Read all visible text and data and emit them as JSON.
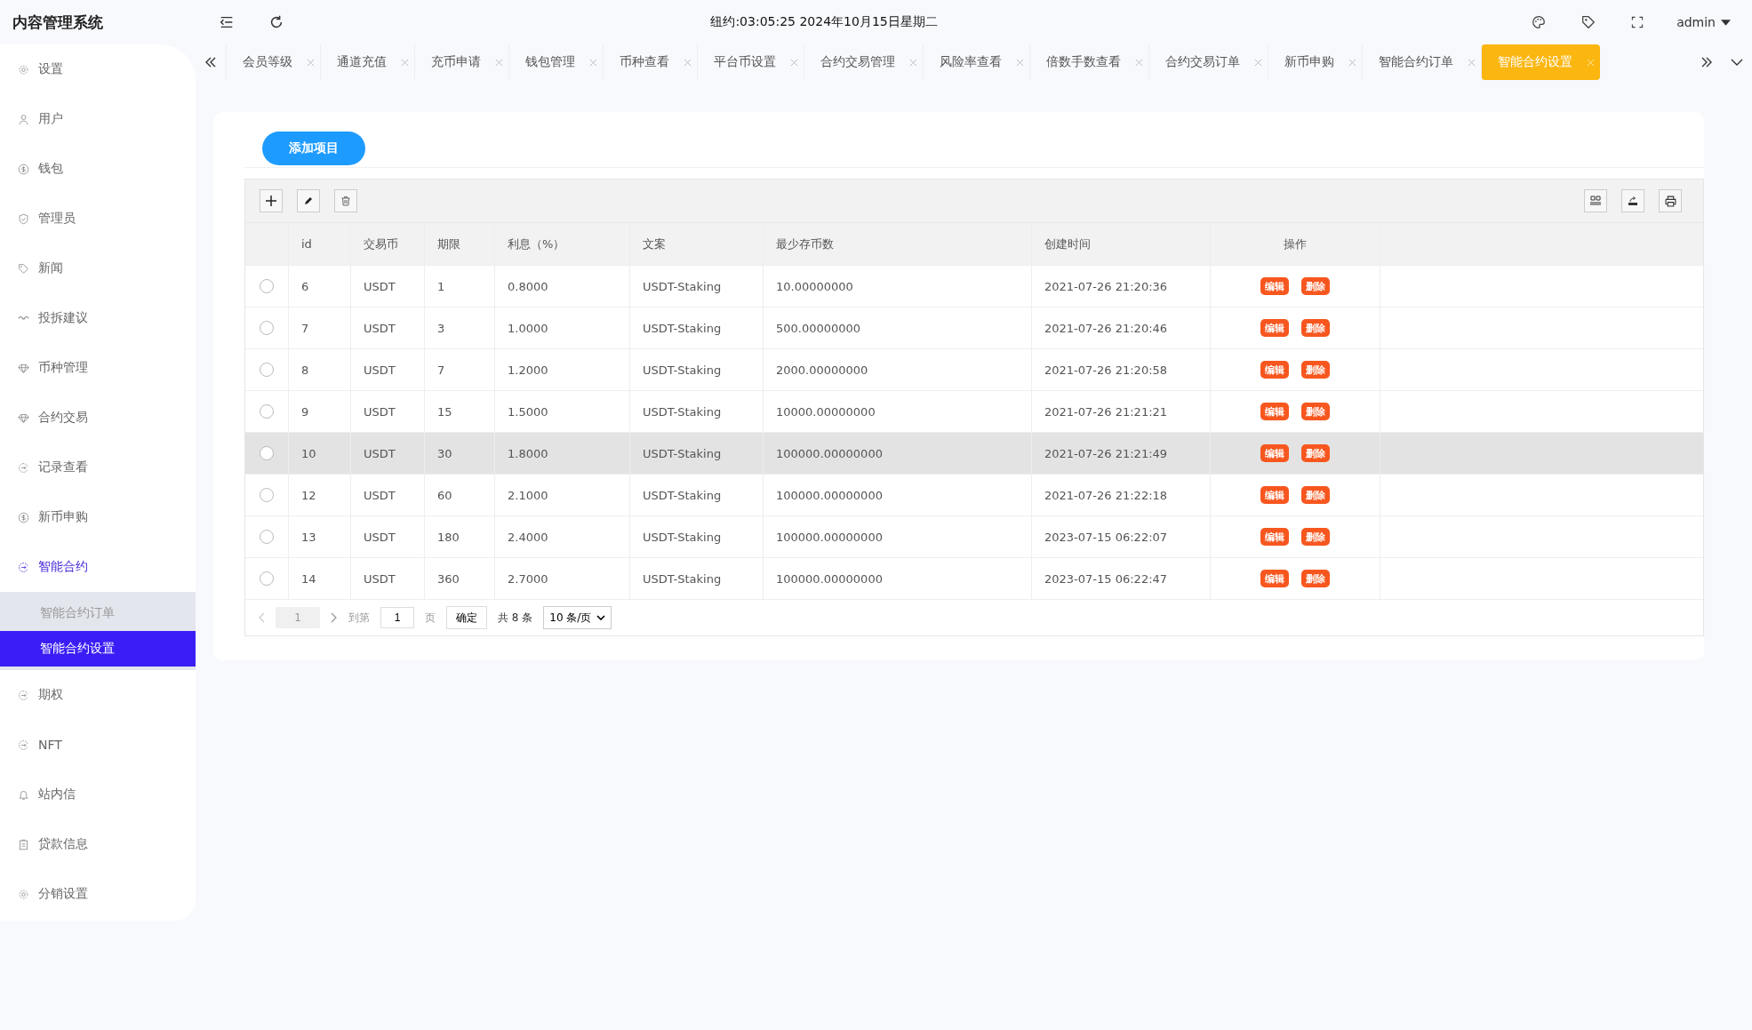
{
  "app_title": "内容管理系统",
  "header": {
    "clock": "纽约:03:05:25 2024年10月15日星期二",
    "user": "admin"
  },
  "sidebar": {
    "items": [
      {
        "label": "设置",
        "selected": false
      },
      {
        "label": "用户",
        "selected": false
      },
      {
        "label": "钱包",
        "selected": false
      },
      {
        "label": "管理员",
        "selected": false
      },
      {
        "label": "新闻",
        "selected": false
      },
      {
        "label": "投拆建议",
        "selected": false
      },
      {
        "label": "币种管理",
        "selected": false
      },
      {
        "label": "合约交易",
        "selected": false
      },
      {
        "label": "记录查看",
        "selected": false
      },
      {
        "label": "新币申购",
        "selected": false
      },
      {
        "label": "智能合约",
        "selected": true,
        "expanded": true,
        "children": [
          {
            "label": "智能合约订单",
            "selected": false
          },
          {
            "label": "智能合约设置",
            "selected": true
          }
        ]
      },
      {
        "label": "期权",
        "selected": false
      },
      {
        "label": "NFT",
        "selected": false
      },
      {
        "label": "站内信",
        "selected": false
      },
      {
        "label": "贷款信息",
        "selected": false
      },
      {
        "label": "分销设置",
        "selected": false
      }
    ]
  },
  "tabs": [
    {
      "label": "会员等级",
      "selected": false
    },
    {
      "label": "通道充值",
      "selected": false
    },
    {
      "label": "充币申请",
      "selected": false
    },
    {
      "label": "钱包管理",
      "selected": false
    },
    {
      "label": "币种查看",
      "selected": false
    },
    {
      "label": "平台币设置",
      "selected": false
    },
    {
      "label": "合约交易管理",
      "selected": false
    },
    {
      "label": "风险率查看",
      "selected": false
    },
    {
      "label": "倍数手数查看",
      "selected": false
    },
    {
      "label": "合约交易订单",
      "selected": false
    },
    {
      "label": "新币申购",
      "selected": false
    },
    {
      "label": "智能合约订单",
      "selected": false
    },
    {
      "label": "智能合约设置",
      "selected": true
    }
  ],
  "add_button": "添加项目",
  "table": {
    "columns": [
      "id",
      "交易币",
      "期限",
      "利息（%）",
      "文案",
      "最少存币数",
      "创建时间",
      "操作"
    ],
    "rows": [
      {
        "selected": false,
        "highlighted": false,
        "cells": [
          "6",
          "USDT",
          "1",
          "0.8000",
          "USDT-Staking",
          "10.00000000",
          "2021-07-26 21:20:36"
        ],
        "actions": [
          "编辑",
          "删除"
        ]
      },
      {
        "selected": false,
        "highlighted": false,
        "cells": [
          "7",
          "USDT",
          "3",
          "1.0000",
          "USDT-Staking",
          "500.00000000",
          "2021-07-26 21:20:46"
        ],
        "actions": [
          "编辑",
          "删除"
        ]
      },
      {
        "selected": false,
        "highlighted": false,
        "cells": [
          "8",
          "USDT",
          "7",
          "1.2000",
          "USDT-Staking",
          "2000.00000000",
          "2021-07-26 21:20:58"
        ],
        "actions": [
          "编辑",
          "删除"
        ]
      },
      {
        "selected": false,
        "highlighted": false,
        "cells": [
          "9",
          "USDT",
          "15",
          "1.5000",
          "USDT-Staking",
          "10000.00000000",
          "2021-07-26 21:21:21"
        ],
        "actions": [
          "编辑",
          "删除"
        ]
      },
      {
        "selected": false,
        "highlighted": true,
        "cells": [
          "10",
          "USDT",
          "30",
          "1.8000",
          "USDT-Staking",
          "100000.00000000",
          "2021-07-26 21:21:49"
        ],
        "actions": [
          "编辑",
          "删除"
        ]
      },
      {
        "selected": false,
        "highlighted": false,
        "cells": [
          "12",
          "USDT",
          "60",
          "2.1000",
          "USDT-Staking",
          "100000.00000000",
          "2021-07-26 21:22:18"
        ],
        "actions": [
          "编辑",
          "删除"
        ]
      },
      {
        "selected": false,
        "highlighted": false,
        "cells": [
          "13",
          "USDT",
          "180",
          "2.4000",
          "USDT-Staking",
          "100000.00000000",
          "2023-07-15 06:22:07"
        ],
        "actions": [
          "编辑",
          "删除"
        ]
      },
      {
        "selected": false,
        "highlighted": false,
        "cells": [
          "14",
          "USDT",
          "360",
          "2.7000",
          "USDT-Staking",
          "100000.00000000",
          "2023-07-15 06:22:47"
        ],
        "actions": [
          "编辑",
          "删除"
        ]
      }
    ]
  },
  "pagination": {
    "current_page": "1",
    "goto_label": "到第",
    "goto_value": "1",
    "page_unit": "页",
    "confirm": "确定",
    "total": "共 8 条",
    "page_size": "10 条/页"
  }
}
